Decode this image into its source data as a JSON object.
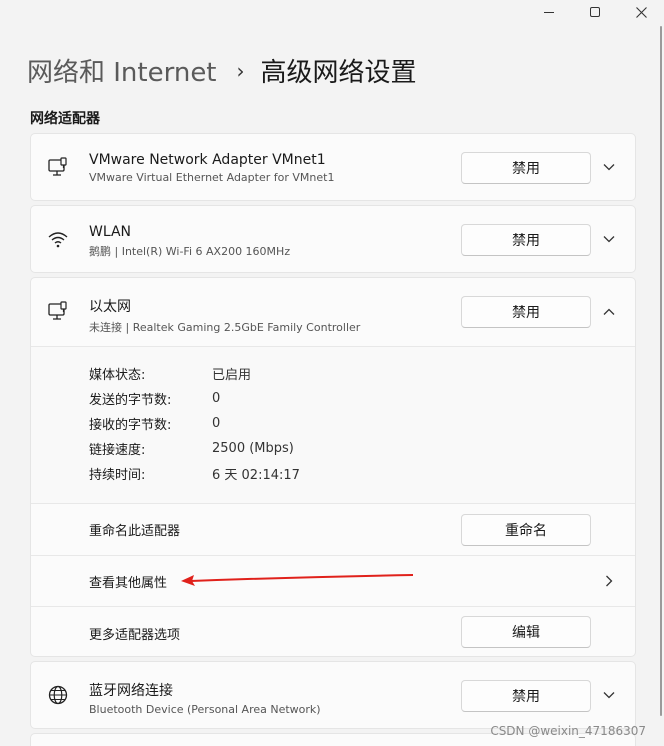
{
  "window": {
    "minimize": "—",
    "maximize": "☐",
    "close": "✕"
  },
  "breadcrumb": {
    "parent": "网络和 Internet",
    "separator": "›",
    "current": "高级网络设置"
  },
  "section_title": "网络适配器",
  "adapters": [
    {
      "title": "VMware Network Adapter VMnet1",
      "subtitle": "VMware Virtual Ethernet Adapter for VMnet1",
      "button": "禁用",
      "icon": "ethernet-icon"
    },
    {
      "title": "WLAN",
      "subtitle": "鹅鹏 | Intel(R) Wi-Fi 6 AX200 160MHz",
      "button": "禁用",
      "icon": "wifi-icon"
    },
    {
      "title": "以太网",
      "subtitle": "未连接 | Realtek Gaming 2.5GbE Family Controller",
      "button": "禁用",
      "icon": "ethernet-icon"
    },
    {
      "title": "蓝牙网络连接",
      "subtitle": "Bluetooth Device (Personal Area Network)",
      "button": "禁用",
      "icon": "globe-icon"
    }
  ],
  "ethernet_details": [
    {
      "key": "媒体状态:",
      "value": "已启用"
    },
    {
      "key": "发送的字节数:",
      "value": "0"
    },
    {
      "key": "接收的字节数:",
      "value": "0"
    },
    {
      "key": "链接速度:",
      "value": "2500 (Mbps)"
    },
    {
      "key": "持续时间:",
      "value": "6 天 02:14:17"
    }
  ],
  "ethernet_actions": {
    "rename_label": "重命名此适配器",
    "rename_button": "重命名",
    "more_props_label": "查看其他属性",
    "more_options_label": "更多适配器选项",
    "edit_button": "编辑"
  },
  "colors": {
    "arrow": "#e0211b"
  },
  "watermark": "CSDN @weixin_47186307"
}
